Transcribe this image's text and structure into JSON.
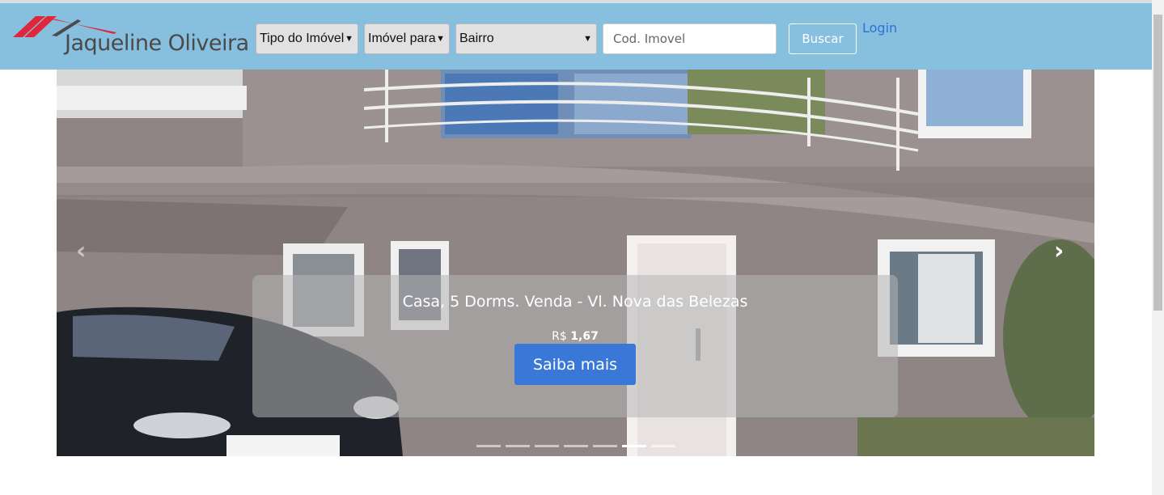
{
  "brand": {
    "name": "Jaqueline Oliveira"
  },
  "search": {
    "tipo_label": "Tipo do Imóvel",
    "finalidade_label": "Imóvel para",
    "bairro_label": "Bairro",
    "codigo_placeholder": "Cod. Imovel",
    "buscar_label": "Buscar"
  },
  "nav": {
    "login_label": "Login"
  },
  "carousel": {
    "prev_icon": "chevron-left-icon",
    "next_icon": "chevron-right-icon",
    "slide": {
      "title": "Casa, 5 Dorms. Venda - Vl. Nova das Belezas",
      "price_prefix": "R$",
      "price_value": "1,67",
      "cta_label": "Saiba mais"
    },
    "slide_count": 7,
    "active_index": 5
  },
  "colors": {
    "navbar": "#87bfdf",
    "cta": "#3a78d8",
    "login_link": "#2f6fd6",
    "logo_mark": "#e0263a"
  }
}
